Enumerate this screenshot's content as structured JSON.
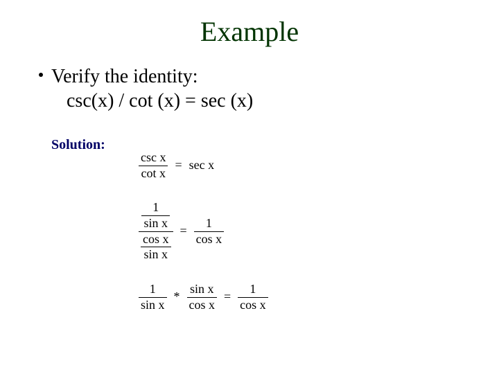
{
  "title": "Example",
  "bullet": {
    "line1": "Verify the identity:",
    "line2": "csc(x) / cot (x) = sec (x)"
  },
  "solution_label": "Solution:",
  "eq1": {
    "lhs_num": "csc x",
    "lhs_den": "cot x",
    "equals": "=",
    "rhs": "sec x"
  },
  "eq2": {
    "top_num": "1",
    "top_den": "sin x",
    "bot_num": "cos x",
    "bot_den": "sin x",
    "equals": "=",
    "rhs_num": "1",
    "rhs_den": "cos x"
  },
  "eq3": {
    "f1_num": "1",
    "f1_den": "sin x",
    "star": "*",
    "f2_num": "sin x",
    "f2_den": "cos x",
    "equals": "=",
    "rhs_num": "1",
    "rhs_den": "cos x"
  },
  "math_font_note": "Times New Roman italic-ish serif look"
}
